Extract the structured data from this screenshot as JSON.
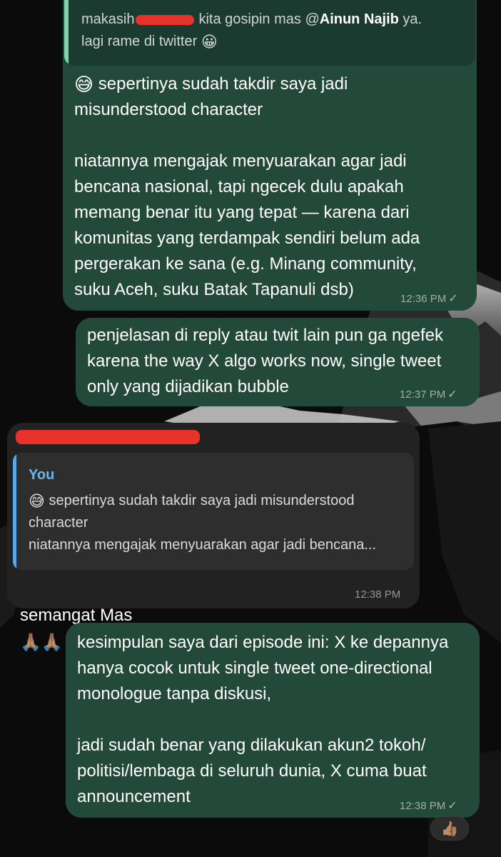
{
  "messages": {
    "m1": {
      "quote": {
        "line1_before": "makasih",
        "line1_after": "kita gosipin mas @",
        "mention": "Ainun Najib",
        "line1_end": " ya.",
        "line2": "lagi rame di twitter",
        "line2_emoji": "😀"
      },
      "emoji": "😅",
      "text_line1": "sepertinya sudah takdir saya jadi",
      "text_rest": "misunderstood character\n\nniatannya mengajak menyuarakan agar jadi\nbencana nasional, tapi ngecek dulu apakah\nmemang benar itu yang tepat — karena dari\nkomunitas yang terdampak sendiri belum ada\npergerakan ke sana (e.g. Minang community,\nsuku Aceh, suku Batak Tapanuli dsb)",
      "time": "12:36 PM",
      "status": "✓"
    },
    "m2": {
      "text": "penjelasan di reply atau twit lain pun ga ngefek\nkarena the way X algo works now, single tweet\nonly yang dijadikan bubble",
      "time": "12:37 PM",
      "status": "✓"
    },
    "m3": {
      "quote": {
        "name": "You",
        "emoji": "😅",
        "line1": " sepertinya sudah takdir saya jadi misunderstood",
        "line2": "character",
        "line3": "niatannya mengajak menyuarakan agar jadi bencana..."
      },
      "text": "semangat Mas",
      "emoji": "🙏🏽🙏🏽",
      "time": "12:38 PM"
    },
    "m4": {
      "text": "kesimpulan saya dari episode ini: X ke depannya\nhanya cocok untuk single tweet one-directional\nmonologue tanpa diskusi,\n\njadi sudah benar yang dilakukan akun2 tokoh/\npolitisi/lembaga di seluruh dunia, X cuma buat\nannouncement",
      "time": "12:38 PM",
      "status": "✓",
      "reaction": "👍🏽"
    }
  },
  "colors": {
    "outgoing_bubble": "#23493b",
    "incoming_bubble": "#222222",
    "quote_accent_green": "#7fd6a9",
    "quote_accent_blue": "#5aa7e6",
    "redaction": "#e8322c"
  }
}
